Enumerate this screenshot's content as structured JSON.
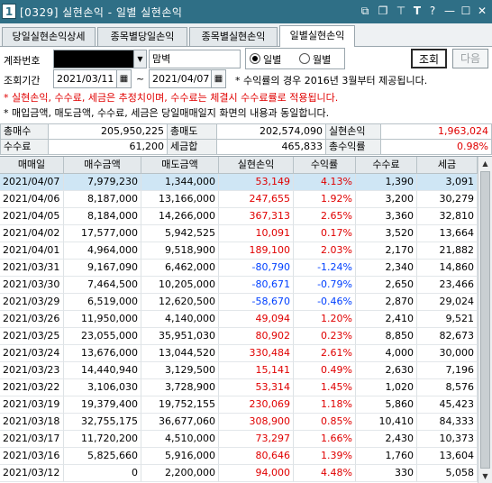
{
  "window": {
    "screen_no": "[0329]",
    "title": "실현손익 - 일별 실현손익",
    "number_badge": "1",
    "icons": [
      "window-snap-icon",
      "copy-window-icon",
      "pin-icon",
      "font-size-icon",
      "help-icon",
      "minimize-icon",
      "maximize-icon",
      "close-icon"
    ],
    "icon_glyphs": [
      "⧉",
      "❐",
      "⊤",
      "T",
      "?",
      "—",
      "☐",
      "✕"
    ]
  },
  "tabs": [
    {
      "label": "당일실현손익상세",
      "active": false
    },
    {
      "label": "종목별당일손익",
      "active": false
    },
    {
      "label": "종목별실현손익",
      "active": false
    },
    {
      "label": "일별실현손익",
      "active": true
    }
  ],
  "form": {
    "account_label": "계좌번호",
    "account_name": "맘벽",
    "period_label": "조회기간",
    "start_date": "2021/03/11",
    "tilde": "~",
    "end_date": "2021/04/07",
    "radio_daily": "일별",
    "radio_monthly": "월별",
    "period_note": "* 수익률의 경우 2016년 3월부터 제공됩니다.",
    "query_button": "조회",
    "next_button": "다음"
  },
  "notes": {
    "red_note": "* 실현손익, 수수료, 세금은 추정치이며, 수수료는 체결시 수수료률로 적용됩니다.",
    "black_note": "* 매입금액, 매도금액, 수수료, 세금은 당일매매일지 화면의 내용과 동일합니다."
  },
  "summary": {
    "total_buy_label": "총매수",
    "total_buy": "205,950,225",
    "total_sell_label": "총매도",
    "total_sell": "202,574,090",
    "realized_label": "실현손익",
    "realized": "1,963,024",
    "fee_label": "수수료",
    "fee": "61,200",
    "tax_total_label": "세금합",
    "tax_total": "465,833",
    "total_return_label": "총수익률",
    "total_return": "0.98%"
  },
  "table": {
    "headers": [
      "매매일",
      "매수금액",
      "매도금액",
      "실현손익",
      "수익률",
      "수수료",
      "세금"
    ],
    "rows": [
      {
        "date": "2021/04/07",
        "buy": "7,979,230",
        "sell": "1,344,000",
        "pnl": "53,149",
        "ret": "4.13%",
        "fee": "1,390",
        "tax": "3,091",
        "sign": "pos"
      },
      {
        "date": "2021/04/06",
        "buy": "8,187,000",
        "sell": "13,166,000",
        "pnl": "247,655",
        "ret": "1.92%",
        "fee": "3,200",
        "tax": "30,279",
        "sign": "pos"
      },
      {
        "date": "2021/04/05",
        "buy": "8,184,000",
        "sell": "14,266,000",
        "pnl": "367,313",
        "ret": "2.65%",
        "fee": "3,360",
        "tax": "32,810",
        "sign": "pos"
      },
      {
        "date": "2021/04/02",
        "buy": "17,577,000",
        "sell": "5,942,525",
        "pnl": "10,091",
        "ret": "0.17%",
        "fee": "3,520",
        "tax": "13,664",
        "sign": "pos"
      },
      {
        "date": "2021/04/01",
        "buy": "4,964,000",
        "sell": "9,518,900",
        "pnl": "189,100",
        "ret": "2.03%",
        "fee": "2,170",
        "tax": "21,882",
        "sign": "pos"
      },
      {
        "date": "2021/03/31",
        "buy": "9,167,090",
        "sell": "6,462,000",
        "pnl": "-80,790",
        "ret": "-1.24%",
        "fee": "2,340",
        "tax": "14,860",
        "sign": "neg"
      },
      {
        "date": "2021/03/30",
        "buy": "7,464,500",
        "sell": "10,205,000",
        "pnl": "-80,671",
        "ret": "-0.79%",
        "fee": "2,650",
        "tax": "23,466",
        "sign": "neg"
      },
      {
        "date": "2021/03/29",
        "buy": "6,519,000",
        "sell": "12,620,500",
        "pnl": "-58,670",
        "ret": "-0.46%",
        "fee": "2,870",
        "tax": "29,024",
        "sign": "neg"
      },
      {
        "date": "2021/03/26",
        "buy": "11,950,000",
        "sell": "4,140,000",
        "pnl": "49,094",
        "ret": "1.20%",
        "fee": "2,410",
        "tax": "9,521",
        "sign": "pos"
      },
      {
        "date": "2021/03/25",
        "buy": "23,055,000",
        "sell": "35,951,030",
        "pnl": "80,902",
        "ret": "0.23%",
        "fee": "8,850",
        "tax": "82,673",
        "sign": "pos"
      },
      {
        "date": "2021/03/24",
        "buy": "13,676,000",
        "sell": "13,044,520",
        "pnl": "330,484",
        "ret": "2.61%",
        "fee": "4,000",
        "tax": "30,000",
        "sign": "pos"
      },
      {
        "date": "2021/03/23",
        "buy": "14,440,940",
        "sell": "3,129,500",
        "pnl": "15,141",
        "ret": "0.49%",
        "fee": "2,630",
        "tax": "7,196",
        "sign": "pos"
      },
      {
        "date": "2021/03/22",
        "buy": "3,106,030",
        "sell": "3,728,900",
        "pnl": "53,314",
        "ret": "1.45%",
        "fee": "1,020",
        "tax": "8,576",
        "sign": "pos"
      },
      {
        "date": "2021/03/19",
        "buy": "19,379,400",
        "sell": "19,752,155",
        "pnl": "230,069",
        "ret": "1.18%",
        "fee": "5,860",
        "tax": "45,423",
        "sign": "pos"
      },
      {
        "date": "2021/03/18",
        "buy": "32,755,175",
        "sell": "36,677,060",
        "pnl": "308,900",
        "ret": "0.85%",
        "fee": "10,410",
        "tax": "84,333",
        "sign": "pos"
      },
      {
        "date": "2021/03/17",
        "buy": "11,720,200",
        "sell": "4,510,000",
        "pnl": "73,297",
        "ret": "1.66%",
        "fee": "2,430",
        "tax": "10,373",
        "sign": "pos"
      },
      {
        "date": "2021/03/16",
        "buy": "5,825,660",
        "sell": "5,916,000",
        "pnl": "80,646",
        "ret": "1.39%",
        "fee": "1,760",
        "tax": "13,604",
        "sign": "pos"
      },
      {
        "date": "2021/03/12",
        "buy": "0",
        "sell": "2,200,000",
        "pnl": "94,000",
        "ret": "4.48%",
        "fee": "330",
        "tax": "5,058",
        "sign": "pos"
      }
    ],
    "selected_row": 0
  },
  "colors": {
    "titlebar": "#2f6f86",
    "positive": "#e00000",
    "negative": "#0040ff",
    "selected_row": "#cfe6f5"
  }
}
